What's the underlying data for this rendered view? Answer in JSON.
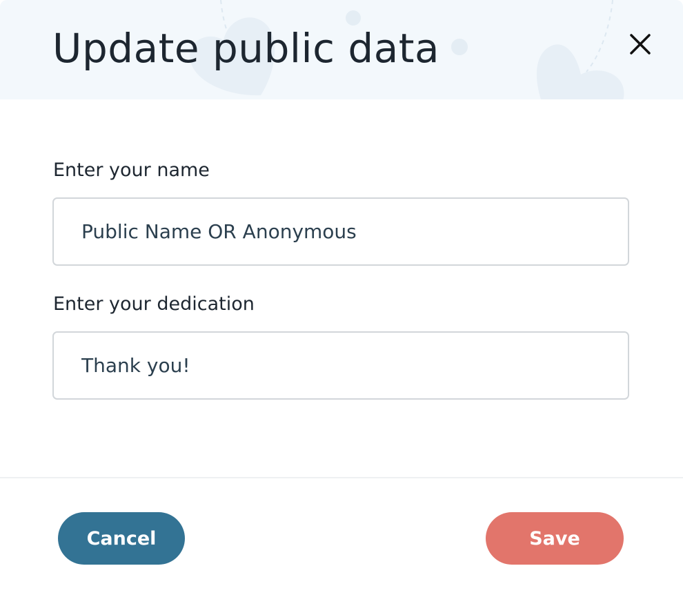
{
  "dialog": {
    "title": "Update public data",
    "close_icon": "close-icon"
  },
  "form": {
    "name_label": "Enter your name",
    "name_value": "Public Name OR Anonymous",
    "dedication_label": "Enter your dedication",
    "dedication_value": "Thank you!"
  },
  "footer": {
    "cancel_label": "Cancel",
    "save_label": "Save"
  },
  "colors": {
    "header_background": "#f3f8fc",
    "cancel_button": "#337394",
    "save_button": "#e2756b",
    "text": "#1d2630",
    "input_border": "#d2d6da"
  }
}
